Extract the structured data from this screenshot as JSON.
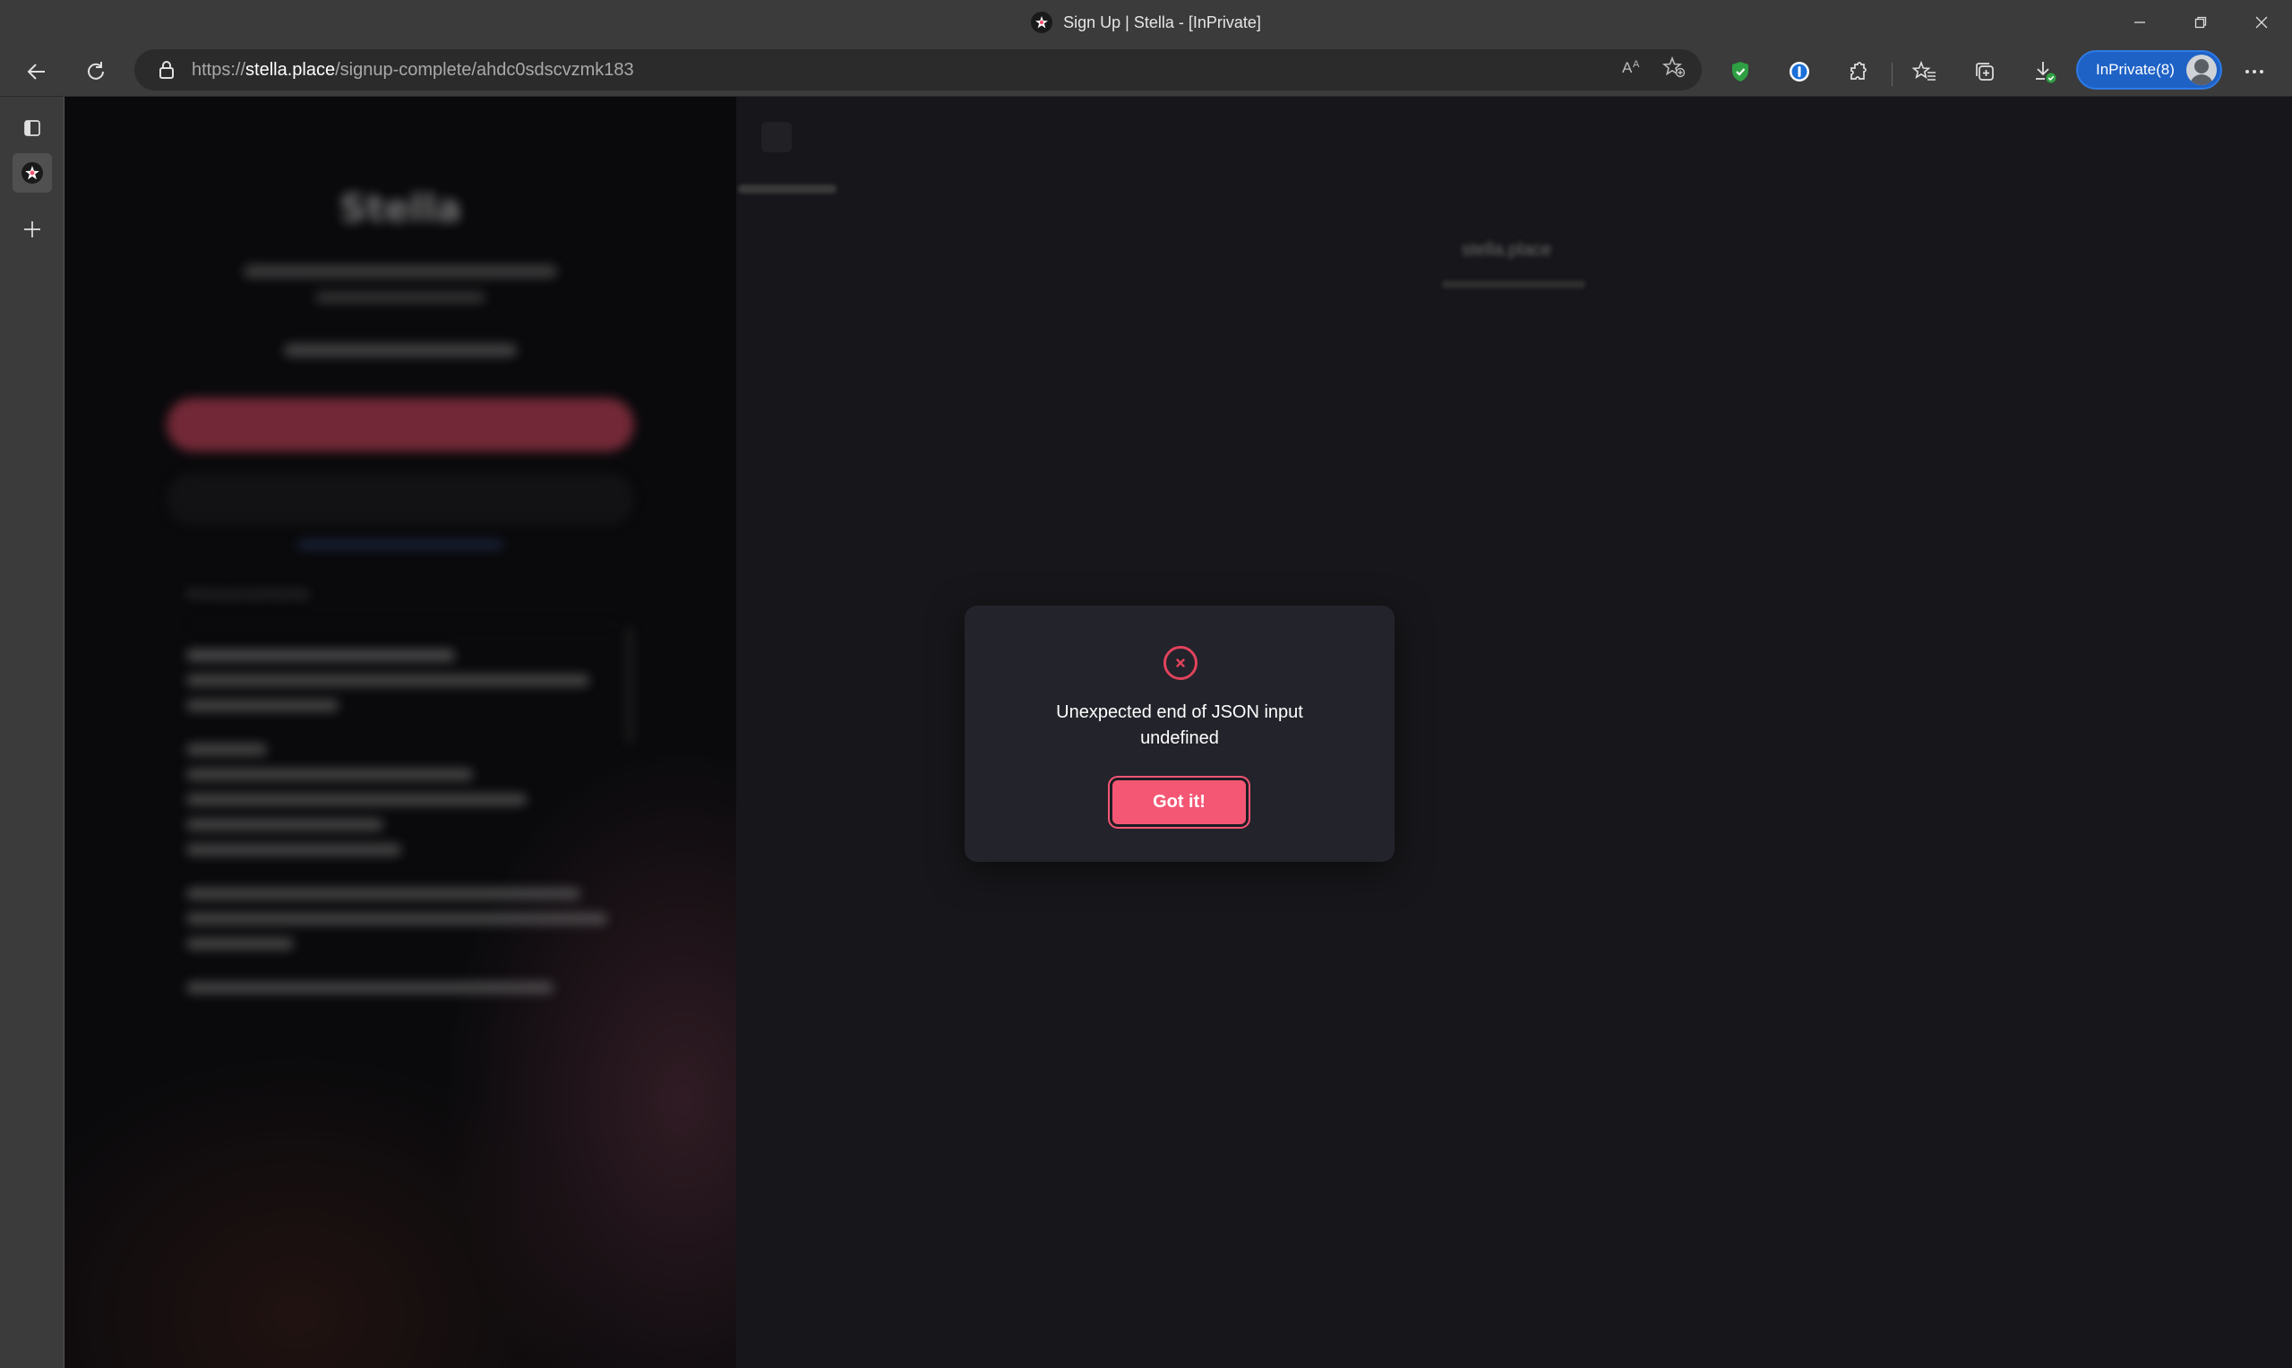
{
  "window": {
    "title": "Sign Up | Stella - [InPrivate]",
    "controls": [
      "minimize",
      "restore",
      "close"
    ]
  },
  "toolbar": {
    "url_scheme": "https://",
    "url_host": "stella.place",
    "url_path": "/signup-complete/ahdc0sdscvzmk183",
    "inprivate_label": "InPrivate(8)"
  },
  "icons": [
    "back-icon",
    "refresh-icon",
    "lock-icon",
    "read-aloud-icon",
    "add-favorite-icon",
    "shield-extension-icon",
    "password-manager-icon",
    "extensions-icon",
    "favorites-icon",
    "collections-icon",
    "downloads-icon",
    "more-icon",
    "tab-actions-icon",
    "new-tab-icon"
  ],
  "colors": {
    "accent": "#f45774",
    "error": "#e2435c",
    "modal_bg": "#23232b",
    "inprivate": "#1e62c6"
  },
  "left_panel": {
    "title": "Stella",
    "section_title": "Announcements"
  },
  "right_panel": {
    "brand": "stella.place"
  },
  "modal": {
    "message_line1": "Unexpected end of JSON input",
    "message_line2": "undefined",
    "button_label": "Got it!"
  }
}
